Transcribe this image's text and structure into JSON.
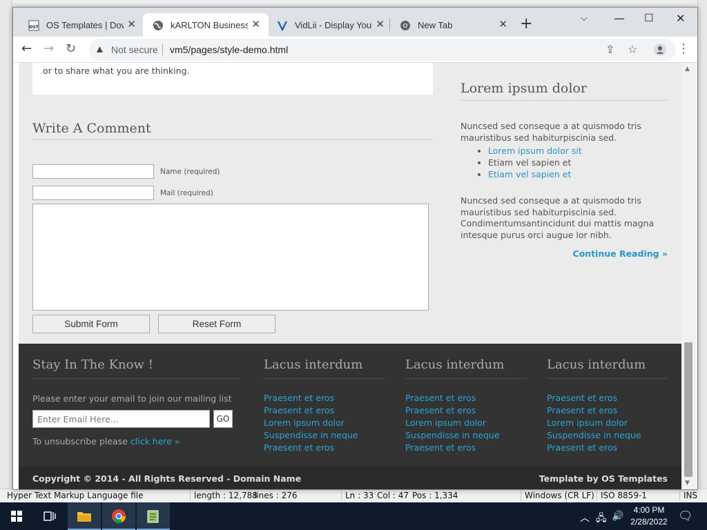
{
  "browser": {
    "tabs": [
      {
        "label": "OS Templates | Down",
        "icon": "ost-favicon",
        "active": false
      },
      {
        "label": "kARLTON Business | S",
        "icon": "globe-icon",
        "active": true
      },
      {
        "label": "VidLii - Display Yours",
        "icon": "vidlii-icon",
        "active": false
      },
      {
        "label": "New Tab",
        "icon": "chrome-icon",
        "active": false
      }
    ],
    "security_label": "Not secure",
    "url": "vm5/pages/style-demo.html"
  },
  "page": {
    "comment_note": "or to share what you are thinking.",
    "write_heading": "Write A Comment",
    "name_label": "Name (required)",
    "mail_label": "Mail (required)",
    "submit_label": "Submit Form",
    "reset_label": "Reset Form",
    "sidebar": {
      "heading": "Lorem ipsum dolor",
      "para1": "Nuncsed sed conseque a at quismodo tris mauristibus sed habiturpiscinia sed.",
      "list": [
        "Lorem ipsum dolor sit",
        "Etiam vel sapien et",
        "Etiam vel sapien et"
      ],
      "para2": "Nuncsed sed conseque a at quismodo tris mauristibus sed habiturpiscinia sed. Condimentumsantincidunt dui mattis magna intesque purus orci augue lor nibh.",
      "continue": "Continue Reading »"
    },
    "footer": {
      "stay_heading": "Stay In The Know !",
      "mailing_text": "Please enter your email to join our mailing list",
      "email_placeholder": "Enter Email Here...",
      "go_label": "GO",
      "unsubscribe_text": "To unsubscribe please",
      "unsubscribe_link": "click here »",
      "columns": [
        {
          "heading": "Lacus interdum",
          "links": [
            "Praesent et eros",
            "Praesent et eros",
            "Lorem ipsum dolor",
            "Suspendisse in neque",
            "Praesent et eros"
          ]
        },
        {
          "heading": "Lacus interdum",
          "links": [
            "Praesent et eros",
            "Praesent et eros",
            "Lorem ipsum dolor",
            "Suspendisse in neque",
            "Praesent et eros"
          ]
        },
        {
          "heading": "Lacus interdum",
          "links": [
            "Praesent et eros",
            "Praesent et eros",
            "Lorem ipsum dolor",
            "Suspendisse in neque",
            "Praesent et eros"
          ]
        }
      ],
      "copyright": "Copyright © 2014 - All Rights Reserved - Domain Name",
      "template_by": "Template by OS Templates"
    }
  },
  "editor_status": {
    "file_type": "Hyper Text Markup Language file",
    "length": "length : 12,788",
    "lines": "lines : 276",
    "ln": "Ln : 33",
    "col": "Col : 47",
    "pos": "Pos : 1,334",
    "eol": "Windows (CR LF)",
    "encoding": "ISO 8859-1",
    "mode": "INS"
  },
  "taskbar": {
    "time": "4:00 PM",
    "date": "2/28/2022"
  }
}
